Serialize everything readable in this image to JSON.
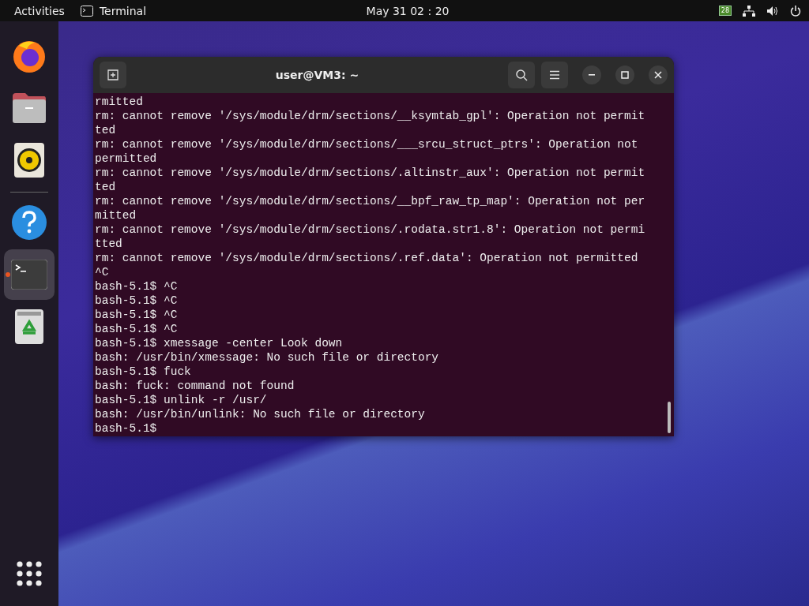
{
  "top_bar": {
    "activities": "Activities",
    "app_menu": "Terminal",
    "clock": "May 31  02 : 20",
    "tray_badge": "28"
  },
  "dock": {
    "items": [
      {
        "kind": "browser",
        "selected": false,
        "running": false
      },
      {
        "kind": "files",
        "selected": false,
        "running": false
      },
      {
        "kind": "music",
        "selected": false,
        "running": false
      },
      {
        "kind": "separator"
      },
      {
        "kind": "help",
        "selected": false,
        "running": false
      },
      {
        "kind": "terminal",
        "selected": true,
        "running": true
      },
      {
        "kind": "trash",
        "selected": false,
        "running": false
      }
    ]
  },
  "window": {
    "title": "user@VM3: ~",
    "lines": [
      "rmitted",
      "rm: cannot remove '/sys/module/drm/sections/__ksymtab_gpl': Operation not permit",
      "ted",
      "rm: cannot remove '/sys/module/drm/sections/___srcu_struct_ptrs': Operation not",
      "permitted",
      "rm: cannot remove '/sys/module/drm/sections/.altinstr_aux': Operation not permit",
      "ted",
      "rm: cannot remove '/sys/module/drm/sections/__bpf_raw_tp_map': Operation not per",
      "mitted",
      "rm: cannot remove '/sys/module/drm/sections/.rodata.str1.8': Operation not permi",
      "tted",
      "rm: cannot remove '/sys/module/drm/sections/.ref.data': Operation not permitted",
      "^C",
      "bash-5.1$ ^C",
      "bash-5.1$ ^C",
      "bash-5.1$ ^C",
      "bash-5.1$ ^C",
      "bash-5.1$ xmessage -center Look down",
      "bash: /usr/bin/xmessage: No such file or directory",
      "bash-5.1$ fuck",
      "bash: fuck: command not found",
      "bash-5.1$ unlink -r /usr/",
      "bash: /usr/bin/unlink: No such file or directory",
      "bash-5.1$ "
    ]
  }
}
